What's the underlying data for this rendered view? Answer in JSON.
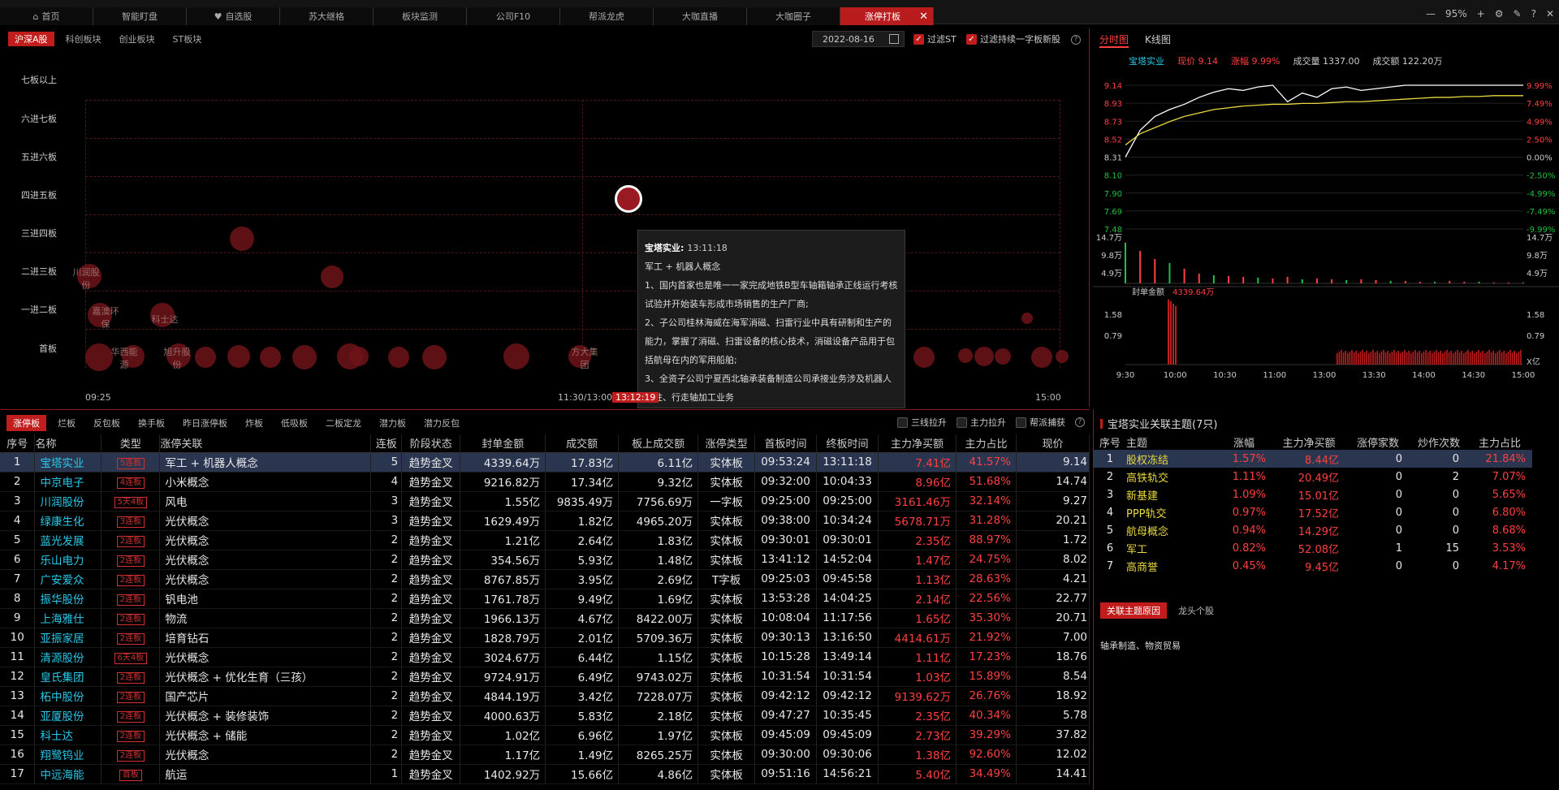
{
  "topbar": {
    "tabs": [
      {
        "label": "首页",
        "icon": "home-icon"
      },
      {
        "label": "智能盯盘"
      },
      {
        "label": "自选股",
        "icon": "heart-icon"
      },
      {
        "label": "苏大继格"
      },
      {
        "label": "板块监测"
      },
      {
        "label": "公司F10"
      },
      {
        "label": "帮派龙虎"
      },
      {
        "label": "大咖直播"
      },
      {
        "label": "大咖圈子"
      },
      {
        "label": "涨停打板"
      }
    ],
    "zoom": "95%"
  },
  "left": {
    "market_tabs": [
      "沪深A股",
      "科创板块",
      "创业板块",
      "ST板块"
    ],
    "date": "2022-08-16",
    "filter_st": "过滤ST",
    "filter_new": "过滤持续一字板新股",
    "row_labels": [
      "七板以上",
      "六进七板",
      "五进六板",
      "四进五板",
      "三进四板",
      "二进三板",
      "一进二板",
      "首板"
    ],
    "bubble_labels": {
      "chuanrun": "川润股份",
      "jiujing": "嘉澳环保",
      "kesida": "科士达",
      "huaxi": "华西能源",
      "xusheng": "旭升股份",
      "fangda": "方大集团"
    },
    "tooltip": {
      "name": "宝塔实业:",
      "time": "13:11:18",
      "concept": "军工 + 机器人概念",
      "p1": "1、国内首家也是唯一一家完成地铁B型车轴箱轴承正线运行考核试验并开始装车形成市场销售的生产厂商;",
      "p2": "2、子公司桂林海威在海军消磁、扫雷行业中具有研制和生产的能力，掌握了消磁、扫雷设备的核心技术，消磁设备产品用于包括航母在内的军用船舶;",
      "p3": "3、全资子公司宁夏西北轴承装备制造公司承接业务涉及机器人立柱、行走轴加工业务"
    },
    "time_axis": {
      "start": "09:25",
      "mid": "11:30/13:00",
      "current": "13:12:19",
      "end": "15:00"
    }
  },
  "right": {
    "tabs": [
      "分时图",
      "K线图"
    ],
    "stock_name": "宝塔实业",
    "price_label": "现价 9.14",
    "change_label": "涨幅 9.99%",
    "volume_label": "成交量 1337.00",
    "amount_label": "成交额 122.20万",
    "price_ticks": [
      "9.14",
      "8.93",
      "8.73",
      "8.52",
      "8.31",
      "8.10",
      "7.90",
      "7.69",
      "7.48"
    ],
    "pct_ticks": [
      "9.99%",
      "7.49%",
      "4.99%",
      "2.50%",
      "0.00%",
      "-2.50%",
      "-4.99%",
      "-7.49%",
      "-9.99%"
    ],
    "vol_ticks": [
      "14.7万",
      "9.8万",
      "4.9万"
    ],
    "seal_label": "封单金额",
    "seal_value": "4339.64万",
    "seal_ticks": [
      "1.58",
      "0.79"
    ],
    "seal_unit": "X亿",
    "time_ticks": [
      "9:30",
      "10:00",
      "10:30",
      "11:00",
      "13:00",
      "13:30",
      "14:00",
      "14:30",
      "15:00"
    ],
    "intraday_prices": [
      8.31,
      8.62,
      8.78,
      8.86,
      8.92,
      9.0,
      9.06,
      9.1,
      9.08,
      9.12,
      9.14,
      8.95,
      9.05,
      9.0,
      9.1,
      9.12,
      9.08,
      9.1,
      9.12,
      9.14,
      9.14,
      9.14,
      9.14,
      9.14,
      9.14,
      9.14,
      9.14,
      9.14
    ],
    "avg_prices": [
      8.45,
      8.58,
      8.65,
      8.72,
      8.78,
      8.82,
      8.86,
      8.88,
      8.9,
      8.91,
      8.92,
      8.92,
      8.93,
      8.93,
      8.94,
      8.95,
      8.95,
      8.96,
      8.97,
      8.98,
      8.99,
      9.0,
      9.0,
      9.01,
      9.01,
      9.02,
      9.02,
      9.02
    ]
  },
  "bottom": {
    "tabs": [
      "涨停板",
      "烂板",
      "反包板",
      "换手板",
      "昨日涨停板",
      "炸板",
      "低吸板",
      "二板定龙",
      "潜力板",
      "潜力反包"
    ],
    "checks": [
      "三线拉升",
      "主力拉升",
      "帮派捕获"
    ],
    "columns": [
      "序号",
      "名称",
      "类型",
      "涨停关联",
      "连板",
      "阶段状态",
      "封单金额",
      "成交额",
      "板上成交额",
      "涨停类型",
      "首板时间",
      "终板时间",
      "主力净买额",
      "主力占比",
      "现价"
    ],
    "rows": [
      [
        "1",
        "宝塔实业",
        "5连板",
        "军工 + 机器人概念",
        "5",
        "趋势金叉",
        "4339.64万",
        "17.83亿",
        "6.11亿",
        "实体板",
        "09:53:24",
        "13:11:18",
        "7.41亿",
        "41.57%",
        "9.14"
      ],
      [
        "2",
        "中京电子",
        "4连板",
        "小米概念",
        "4",
        "趋势金叉",
        "9216.82万",
        "17.34亿",
        "9.32亿",
        "实体板",
        "09:32:00",
        "10:04:33",
        "8.96亿",
        "51.68%",
        "14.74"
      ],
      [
        "3",
        "川润股份",
        "5天4板",
        "风电",
        "3",
        "趋势金叉",
        "1.55亿",
        "9835.49万",
        "7756.69万",
        "一字板",
        "09:25:00",
        "09:25:00",
        "3161.46万",
        "32.14%",
        "9.27"
      ],
      [
        "4",
        "绿康生化",
        "3连板",
        "光伏概念",
        "3",
        "趋势金叉",
        "1629.49万",
        "1.82亿",
        "4965.20万",
        "实体板",
        "09:38:00",
        "10:34:24",
        "5678.71万",
        "31.28%",
        "20.21"
      ],
      [
        "5",
        "蓝光发展",
        "2连板",
        "光伏概念",
        "2",
        "趋势金叉",
        "1.21亿",
        "2.64亿",
        "1.83亿",
        "实体板",
        "09:30:01",
        "09:30:01",
        "2.35亿",
        "88.97%",
        "1.72"
      ],
      [
        "6",
        "乐山电力",
        "2连板",
        "光伏概念",
        "2",
        "趋势金叉",
        "354.56万",
        "5.93亿",
        "1.48亿",
        "实体板",
        "13:41:12",
        "14:52:04",
        "1.47亿",
        "24.75%",
        "8.02"
      ],
      [
        "7",
        "广安爱众",
        "2连板",
        "光伏概念",
        "2",
        "趋势金叉",
        "8767.85万",
        "3.95亿",
        "2.69亿",
        "T字板",
        "09:25:03",
        "09:45:58",
        "1.13亿",
        "28.63%",
        "4.21"
      ],
      [
        "8",
        "振华股份",
        "2连板",
        "钒电池",
        "2",
        "趋势金叉",
        "1761.78万",
        "9.49亿",
        "1.69亿",
        "实体板",
        "13:53:28",
        "14:04:25",
        "2.14亿",
        "22.56%",
        "22.77"
      ],
      [
        "9",
        "上海雅仕",
        "2连板",
        "物流",
        "2",
        "趋势金叉",
        "1966.13万",
        "4.67亿",
        "8422.00万",
        "实体板",
        "10:08:04",
        "11:17:56",
        "1.65亿",
        "35.30%",
        "20.71"
      ],
      [
        "10",
        "亚振家居",
        "2连板",
        "培育钻石",
        "2",
        "趋势金叉",
        "1828.79万",
        "2.01亿",
        "5709.36万",
        "实体板",
        "09:30:13",
        "13:16:50",
        "4414.61万",
        "21.92%",
        "7.00"
      ],
      [
        "11",
        "清源股份",
        "6天4板",
        "光伏概念",
        "2",
        "趋势金叉",
        "3024.67万",
        "6.44亿",
        "1.15亿",
        "实体板",
        "10:15:28",
        "13:49:14",
        "1.11亿",
        "17.23%",
        "18.76"
      ],
      [
        "12",
        "皇氏集团",
        "2连板",
        "光伏概念 + 优化生育（三孩）",
        "2",
        "趋势金叉",
        "9724.91万",
        "6.49亿",
        "9743.02万",
        "实体板",
        "10:31:54",
        "10:31:54",
        "1.03亿",
        "15.89%",
        "8.54"
      ],
      [
        "13",
        "柘中股份",
        "2连板",
        "国产芯片",
        "2",
        "趋势金叉",
        "4844.19万",
        "3.42亿",
        "7228.07万",
        "实体板",
        "09:42:12",
        "09:42:12",
        "9139.62万",
        "26.76%",
        "18.92"
      ],
      [
        "14",
        "亚厦股份",
        "2连板",
        "光伏概念 + 装修装饰",
        "2",
        "趋势金叉",
        "4000.63万",
        "5.83亿",
        "2.18亿",
        "实体板",
        "09:47:27",
        "10:35:45",
        "2.35亿",
        "40.34%",
        "5.78"
      ],
      [
        "15",
        "科士达",
        "2连板",
        "光伏概念 + 储能",
        "2",
        "趋势金叉",
        "1.02亿",
        "6.96亿",
        "1.97亿",
        "实体板",
        "09:45:09",
        "09:45:09",
        "2.73亿",
        "39.29%",
        "37.82"
      ],
      [
        "16",
        "翔鹭钨业",
        "2连板",
        "光伏概念",
        "2",
        "趋势金叉",
        "1.17亿",
        "1.49亿",
        "8265.25万",
        "实体板",
        "09:30:00",
        "09:30:06",
        "1.38亿",
        "92.60%",
        "12.02"
      ],
      [
        "17",
        "中远海能",
        "首板",
        "航运",
        "1",
        "趋势金叉",
        "1402.92万",
        "15.66亿",
        "4.86亿",
        "实体板",
        "09:51:16",
        "14:56:21",
        "5.40亿",
        "34.49%",
        "14.41"
      ]
    ]
  },
  "related": {
    "title": "宝塔实业关联主题(7只)",
    "columns": [
      "序号",
      "主题",
      "涨幅",
      "主力净买额",
      "涨停家数",
      "炒作次数",
      "主力占比"
    ],
    "rows": [
      [
        "1",
        "股权冻结",
        "1.57%",
        "8.44亿",
        "0",
        "0",
        "21.84%"
      ],
      [
        "2",
        "高铁轨交",
        "1.11%",
        "20.49亿",
        "0",
        "2",
        "7.07%"
      ],
      [
        "3",
        "新基建",
        "1.09%",
        "15.01亿",
        "0",
        "0",
        "5.65%"
      ],
      [
        "4",
        "PPP轨交",
        "0.97%",
        "17.52亿",
        "0",
        "0",
        "6.80%"
      ],
      [
        "5",
        "航母概念",
        "0.94%",
        "14.29亿",
        "0",
        "0",
        "8.68%"
      ],
      [
        "6",
        "军工",
        "0.82%",
        "52.08亿",
        "1",
        "15",
        "3.53%"
      ],
      [
        "7",
        "高商誉",
        "0.45%",
        "9.45亿",
        "0",
        "0",
        "4.17%"
      ]
    ],
    "reason_tabs": [
      "关联主题原因",
      "龙头个股"
    ],
    "reason_text": "轴承制造、物资贸易"
  },
  "colors": {
    "accent": "#c21d1d",
    "up": "#ff4040",
    "down": "#20c040",
    "name": "#28c8e8",
    "theme": "#e8d840"
  }
}
